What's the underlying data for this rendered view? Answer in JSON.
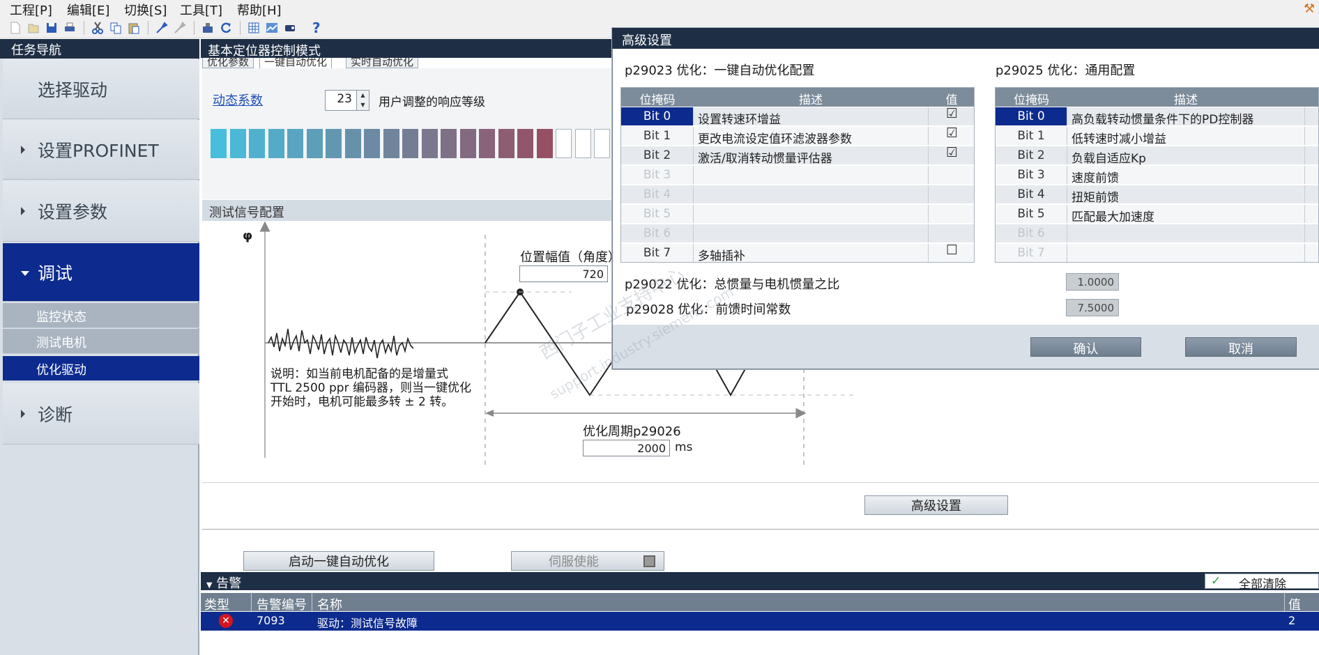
{
  "menubar": {
    "items": [
      "工程[P]",
      "编辑[E]",
      "切换[S]",
      "工具[T]",
      "帮助[H]"
    ]
  },
  "nav": {
    "header": "任务导航",
    "sections": {
      "select_drive": "选择驱动",
      "profinet": "设置PROFINET",
      "params": "设置参数",
      "commissioning": "调试",
      "diagnosis": "诊断"
    },
    "sub_items": [
      "监控状态",
      "测试电机",
      "优化驱动"
    ]
  },
  "main": {
    "header": "基本定位器控制模式",
    "tabs": [
      "优化参数",
      "一键自动优化",
      "实时自动优化"
    ],
    "dynamic_link": "动态系数",
    "dynamic_value": "23",
    "dynamic_desc": "用户调整的响应等级",
    "dynamic_level": 23,
    "signal_header": "测试信号配置",
    "phi": "φ",
    "pos_amp_label": "位置幅值（角度）",
    "pos_amp_value": "720",
    "note": [
      "说明：如当前电机配备的是增量式",
      "TTL 2500 ppr 编码器，则当一键优化",
      "开始时，电机可能最多转 ± 2 转。"
    ],
    "period_label": "优化周期p29026",
    "period_value": "2000",
    "period_unit": "ms",
    "advanced_button": "高级设置",
    "start_button": "启动一键自动优化",
    "servo_button": "伺服使能"
  },
  "alarm": {
    "header": "告警",
    "clear_all": "全部清除",
    "columns": [
      "类型",
      "告警编号",
      "名称",
      "值"
    ],
    "rows": [
      {
        "number": "7093",
        "name": "驱动：测试信号故障",
        "value": "2"
      }
    ]
  },
  "dialog": {
    "title": "高级设置",
    "p29023_title": "p29023 优化：一键自动优化配置",
    "p29025_title": "p29025 优化：通用配置",
    "col_bitmask": "位掩码",
    "col_desc": "描述",
    "col_value": "值",
    "left_rows": [
      {
        "bit": "Bit 0",
        "desc": "设置转速环增益",
        "checked": "☑"
      },
      {
        "bit": "Bit 1",
        "desc": "更改电流设定值环滤波器参数",
        "checked": "☑"
      },
      {
        "bit": "Bit 2",
        "desc": "激活/取消转动惯量评估器",
        "checked": "☑"
      },
      {
        "bit": "Bit 3",
        "desc": "",
        "checked": ""
      },
      {
        "bit": "Bit 4",
        "desc": "",
        "checked": ""
      },
      {
        "bit": "Bit 5",
        "desc": "",
        "checked": ""
      },
      {
        "bit": "Bit 6",
        "desc": "",
        "checked": ""
      },
      {
        "bit": "Bit 7",
        "desc": "多轴插补",
        "checked": "☐"
      }
    ],
    "right_rows": [
      {
        "bit": "Bit 0",
        "desc": "高负载转动惯量条件下的PD控制器"
      },
      {
        "bit": "Bit 1",
        "desc": "低转速时减小增益"
      },
      {
        "bit": "Bit 2",
        "desc": "负载自适应Kp"
      },
      {
        "bit": "Bit 3",
        "desc": "速度前馈"
      },
      {
        "bit": "Bit 4",
        "desc": "扭矩前馈"
      },
      {
        "bit": "Bit 5",
        "desc": "匹配最大加速度"
      },
      {
        "bit": "Bit 6",
        "desc": ""
      },
      {
        "bit": "Bit 7",
        "desc": ""
      }
    ],
    "p29022_label": "p29022 优化：总惯量与电机惯量之比",
    "p29022_value": "1.0000",
    "p29028_label": "p29028 优化：前馈时间常数",
    "p29028_value": "7.5000",
    "ok": "确认",
    "cancel": "取消"
  },
  "watermark": [
    "西门子工业支持中心",
    "support.industry.siemens.com"
  ],
  "colors": {
    "accent": "#0d2b8e",
    "header": "#1e2f45",
    "alarm_red": "#d8141e"
  }
}
